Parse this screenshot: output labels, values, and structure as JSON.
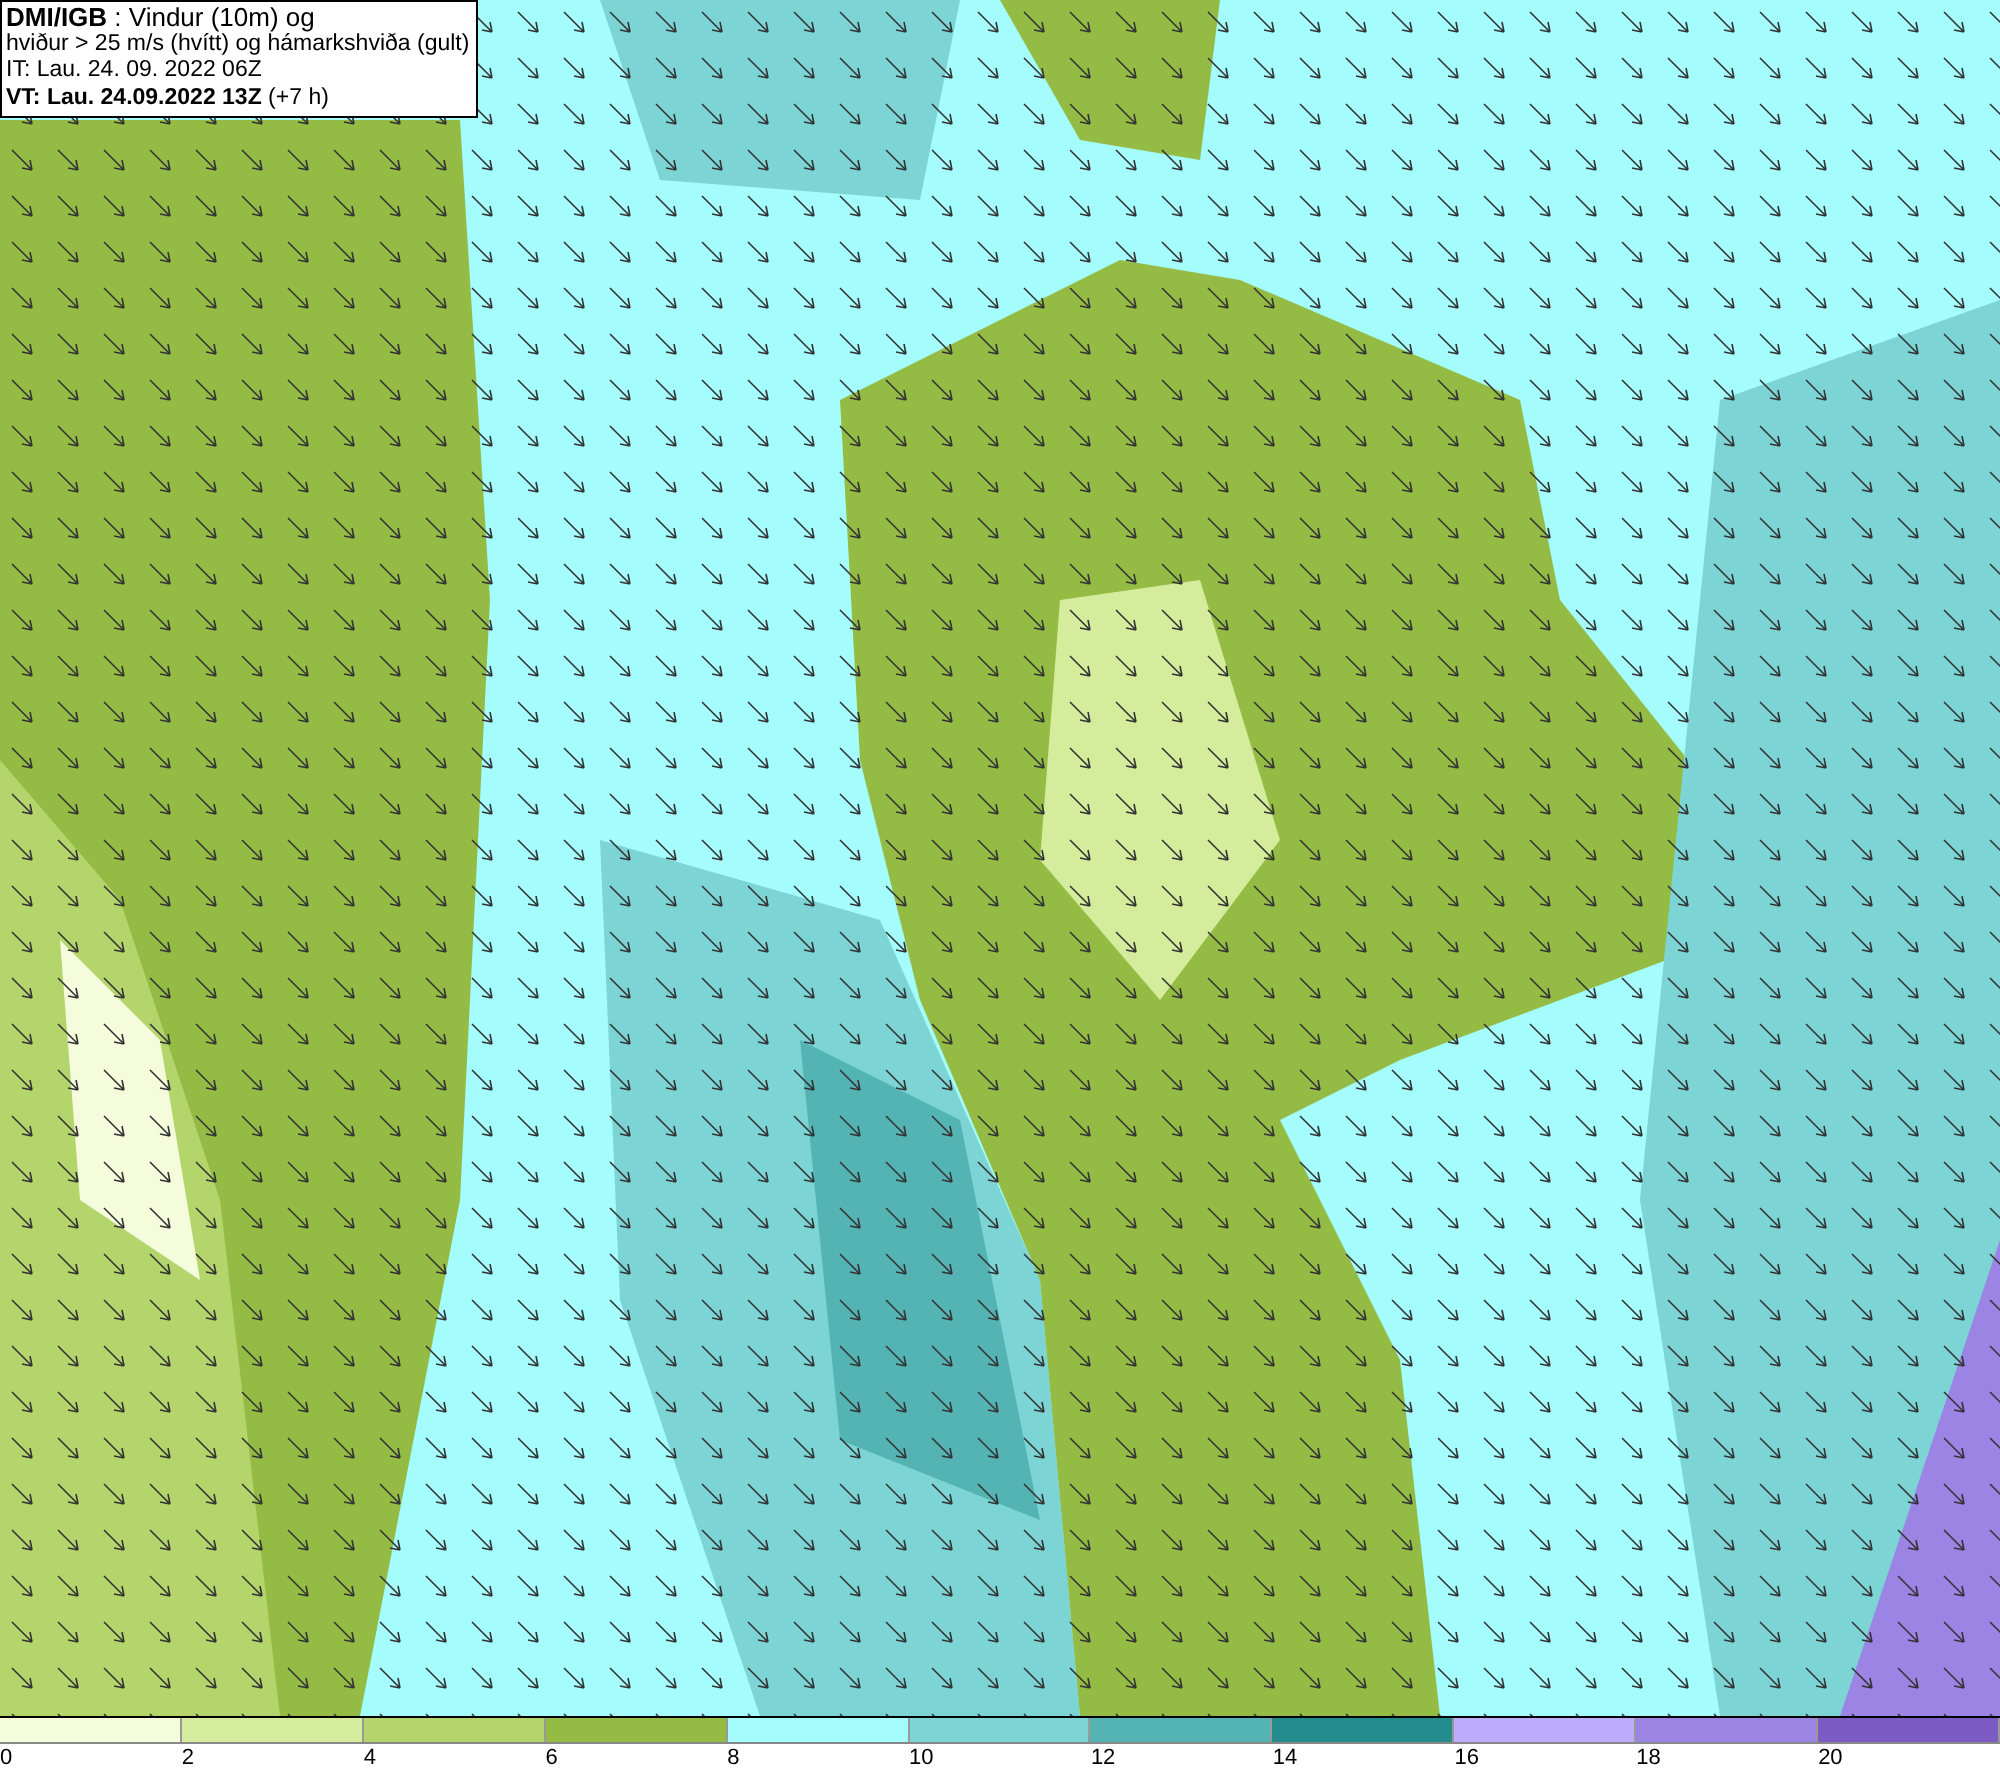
{
  "header": {
    "lines": [
      "**DMI/IGB** : Vindur (10m) og",
      "hviður > 25 m/s (hvítt) og hámarkshviða (gult)",
      "IT: Lau. 24. 09. 2022 06Z",
      "**VT: Lau. 24.09.2022 13Z** (+7 h)"
    ]
  },
  "legend": [
    {
      "label": "0",
      "color": "#f4fcdc"
    },
    {
      "label": "2",
      "color": "#d4ec9c"
    },
    {
      "label": "4",
      "color": "#b4d46c"
    },
    {
      "label": "6",
      "color": "#94bc44"
    },
    {
      "label": "8",
      "color": "#a4fcfc"
    },
    {
      "label": "10",
      "color": "#7cd4d4"
    },
    {
      "label": "12",
      "color": "#54b4b4"
    },
    {
      "label": "14",
      "color": "#248c8c"
    },
    {
      "label": "16",
      "color": "#bcacfc"
    },
    {
      "label": "18",
      "color": "#9c84e4"
    },
    {
      "label": "20",
      "color": "#7c5cc4"
    }
  ]
}
